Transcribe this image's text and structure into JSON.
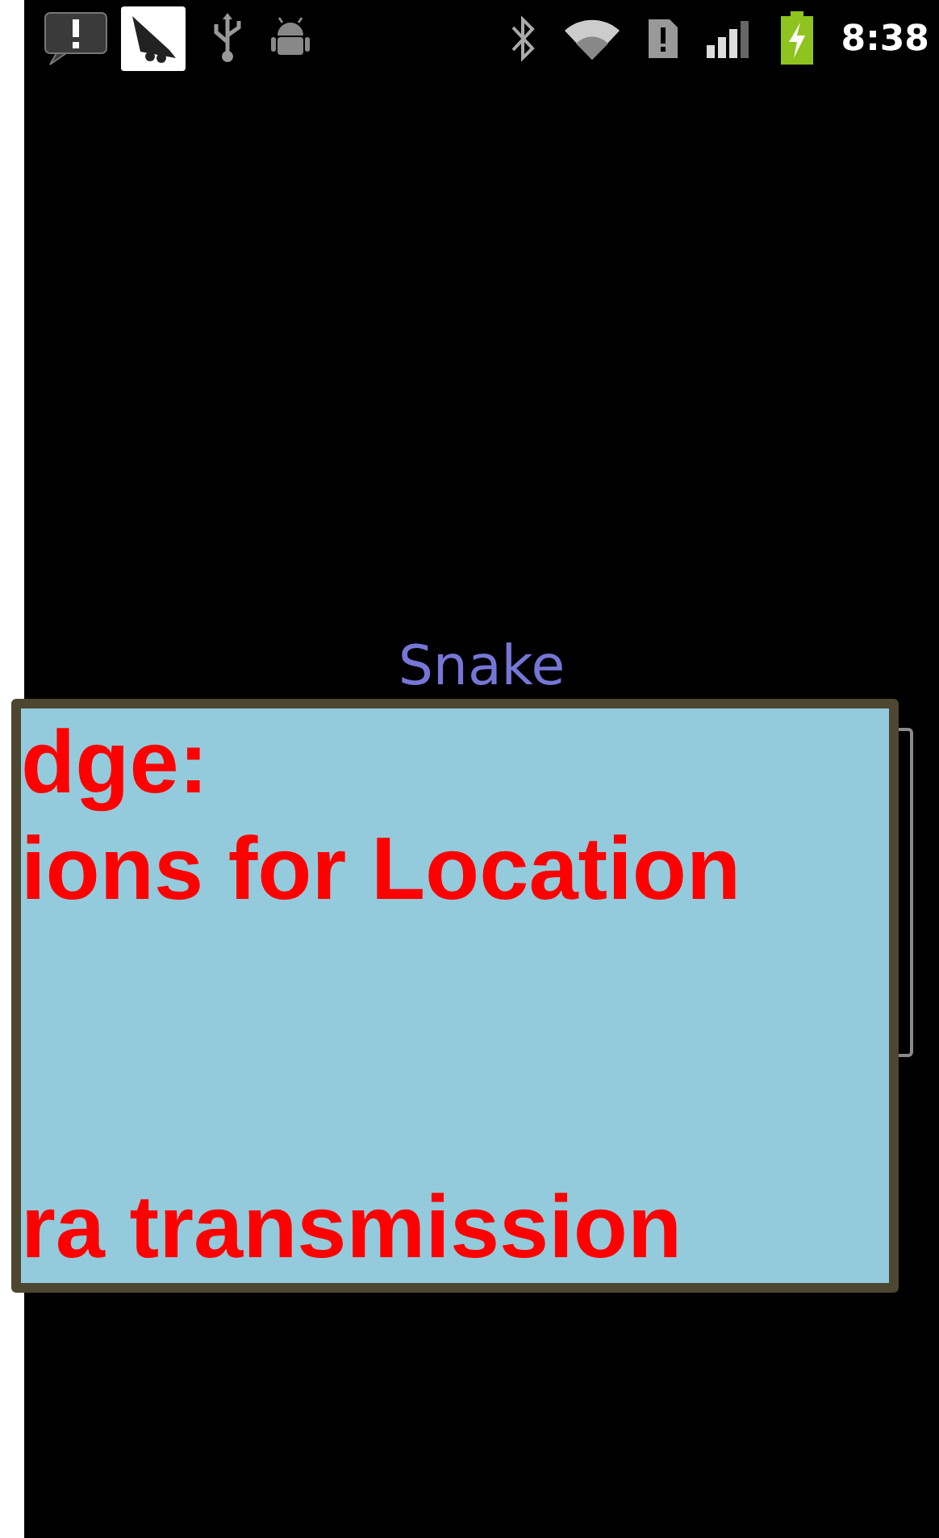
{
  "status_bar": {
    "time": "8:38"
  },
  "app_title": "Snake",
  "overlay": {
    "lines": [
      "dge:",
      "ions for Location",
      "ra transmission"
    ]
  }
}
